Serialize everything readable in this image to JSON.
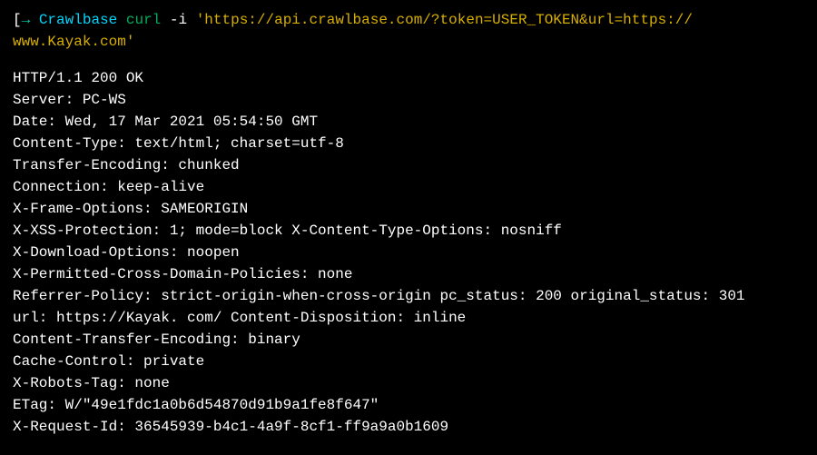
{
  "prompt": {
    "bracket": "[",
    "arrow": "→",
    "hostname": "Crawlbase",
    "command": "curl",
    "flag": "-i",
    "url_line1": "'https://api.crawlbase.com/?token=USER_TOKEN&url=https://",
    "url_line2": "www.Kayak.com'"
  },
  "output": {
    "lines": [
      "HTTP/1.1 200 OK",
      "Server: PC-WS",
      "Date: Wed, 17 Mar 2021 05:54:50 GMT",
      "Content-Type: text/html; charset=utf-8",
      "Transfer-Encoding: chunked",
      "Connection: keep-alive",
      "X-Frame-Options: SAMEORIGIN",
      "X-XSS-Protection: 1; mode=block X-Content-Type-Options: nosniff",
      "X-Download-Options: noopen",
      "X-Permitted-Cross-Domain-Policies: none",
      "Referrer-Policy: strict-origin-when-cross-origin pc_status: 200 original_status: 301",
      "url: https://Kayak. com/ Content-Disposition: inline",
      "Content-Transfer-Encoding: binary",
      "Cache-Control: private",
      "X-Robots-Tag: none",
      "ETag: W/\"49e1fdc1a0b6d54870d91b9a1fe8f647\"",
      "X-Request-Id: 36545939-b4c1-4a9f-8cf1-ff9a9a0b1609"
    ]
  }
}
